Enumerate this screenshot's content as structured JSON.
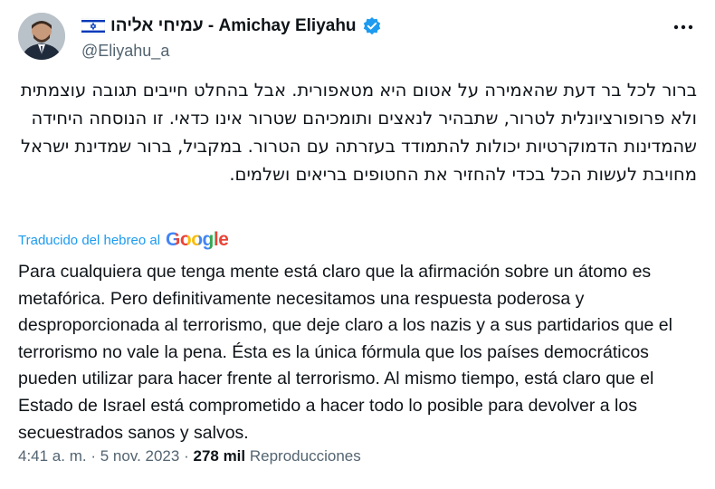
{
  "author": {
    "display_name": "עמיחי אליהו - Amichay Eliyahu",
    "handle": "@Eliyahu_a",
    "verified": true,
    "flag_icon": "israel-flag-icon",
    "verified_icon": "verified-badge-icon",
    "badge_color": "#1d9bf0"
  },
  "tweet": {
    "original_text": "ברור לכל בר דעת שהאמירה על אטום היא מטאפורית. אבל בהחלט חייבים תגובה עוצמתית ולא פרופורציונלית לטרור, שתבהיר לנאצים ותומכיהם שטרור אינו כדאי. זו הנוסחה היחידה שהמדינות הדמוקרטיות יכולות להתמודד בעזרתה עם הטרור. במקביל, ברור שמדינת ישראל מחויבת לעשות הכל בכדי להחזיר את החטופים בריאים ושלמים.",
    "translated_label": "Traducido del hebreo al",
    "translation_provider": "Google",
    "translated_text": "Para cualquiera que tenga mente está claro que la afirmación sobre un átomo es metafórica. Pero definitivamente necesitamos una respuesta poderosa y desproporcionada al terrorismo, que deje claro a los nazis y a sus partidarios que el terrorismo no vale la pena. Ésta es la única fórmula que los países democráticos pueden utilizar para hacer frente al terrorismo. Al mismo tiempo, está claro que el Estado de Israel está comprometido a hacer todo lo posible para devolver a los secuestrados sanos y salvos.",
    "time": "4:41 a. m.",
    "date": "5 nov. 2023",
    "separator": "·",
    "views_count": "278 mil",
    "views_label": "Reproducciones"
  },
  "colors": {
    "text": "#0f1419",
    "secondary": "#536471",
    "link": "#1d9bf0"
  }
}
